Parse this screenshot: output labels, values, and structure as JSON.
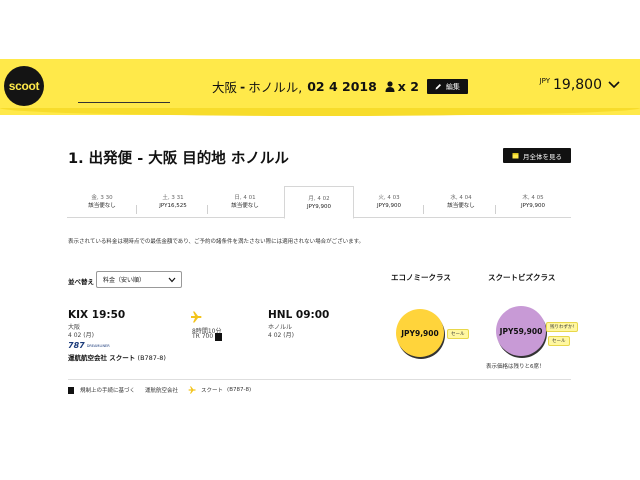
{
  "brand": {
    "logo_text": "scoot",
    "primary_color": "#ffe94a",
    "dark_color": "#141414"
  },
  "header": {
    "origin": "大阪",
    "separator": "-",
    "destination": "ホノルル,",
    "date": "02 4 2018",
    "passenger_icon": "person-icon",
    "passenger_count": "x 2",
    "edit_icon": "pencil-icon",
    "edit_label": "編集",
    "total_currency": "JPY",
    "total_amount": "19,800",
    "expand_icon": "chevron-down-icon"
  },
  "section": {
    "title": "1. 出発便 - 大阪 目的地 ホノルル",
    "calendar_icon": "calendar-icon",
    "calendar_button": "月全体を見る"
  },
  "date_tabs": [
    {
      "date": "金, 3 30",
      "price": "該当便なし",
      "active": false
    },
    {
      "date": "土, 3 31",
      "price": "JPY16,525",
      "active": false
    },
    {
      "date": "日, 4 01",
      "price": "該当便なし",
      "active": false
    },
    {
      "date": "月, 4 02",
      "price": "JPY9,900",
      "active": true
    },
    {
      "date": "火, 4 03",
      "price": "JPY9,900",
      "active": false
    },
    {
      "date": "水, 4 04",
      "price": "該当便なし",
      "active": false
    },
    {
      "date": "木, 4 05",
      "price": "JPY9,900",
      "active": false
    }
  ],
  "disclaimer": "表示されている料金は現時点での最低金額であり、ご予約の諸条件を満たさない際には適用されない場合がございます。",
  "sort": {
    "label": "並べ替え",
    "selected": "料金（安い順）"
  },
  "classes": {
    "economy": "エコノミークラス",
    "scootbiz": "スクートビズクラス"
  },
  "flight": {
    "departure_time": "KIX 19:50",
    "departure_city": "大阪",
    "departure_date": "4 02 (月)",
    "aircraft_logo": "787",
    "aircraft_logo_sub": "DREAMLINER",
    "operator": "運航航空会社 スクート",
    "aircraft": "(B787-8)",
    "duration": "8時間10分",
    "flight_no": "TR 700",
    "arrival_time": "HNL 09:00",
    "arrival_city": "ホノルル",
    "arrival_date": "4 02 (月)",
    "economy_fare": "JPY9,900",
    "economy_tag": "セール",
    "biz_fare": "JPY59,900",
    "biz_tag_remaining": "残りわずか!",
    "biz_tag_sale": "セール",
    "biz_note": "表示価格は残りと6席！"
  },
  "legend": {
    "schedule_note": "規制上の手続に基づく",
    "operator_label": "運航航空会社",
    "scoot_label": "スクート",
    "scoot_aircraft": "(B787-8)"
  }
}
